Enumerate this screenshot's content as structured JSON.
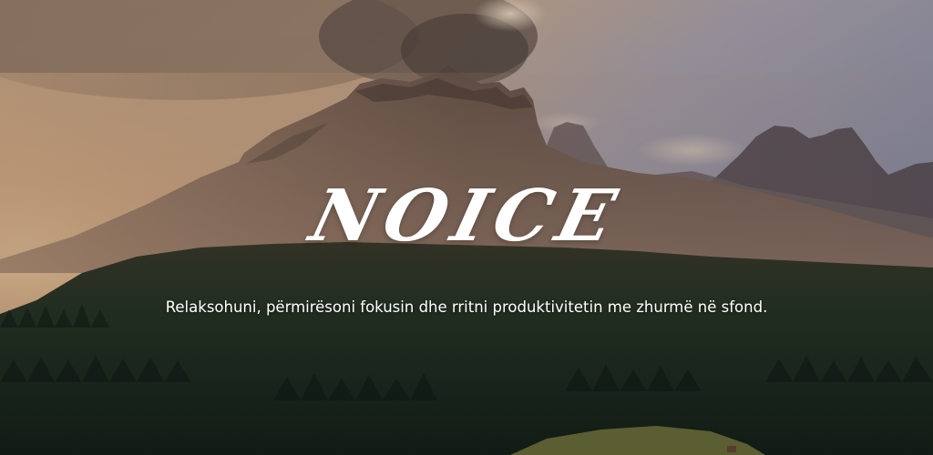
{
  "banner": {
    "title": "NOICE",
    "tagline": "Relaksohuni, përmirësoni fokusin dhe rritni produktivitetin me zhurmë në sfond."
  },
  "background": {
    "subject": "mountain-forest-sunset-photo",
    "colors": {
      "sky_warm": "#d9b48e",
      "sky_cool": "#8f93a8",
      "mountain": "#6e5a4d",
      "forest": "#1f3024",
      "meadow": "#8a8a45"
    }
  }
}
